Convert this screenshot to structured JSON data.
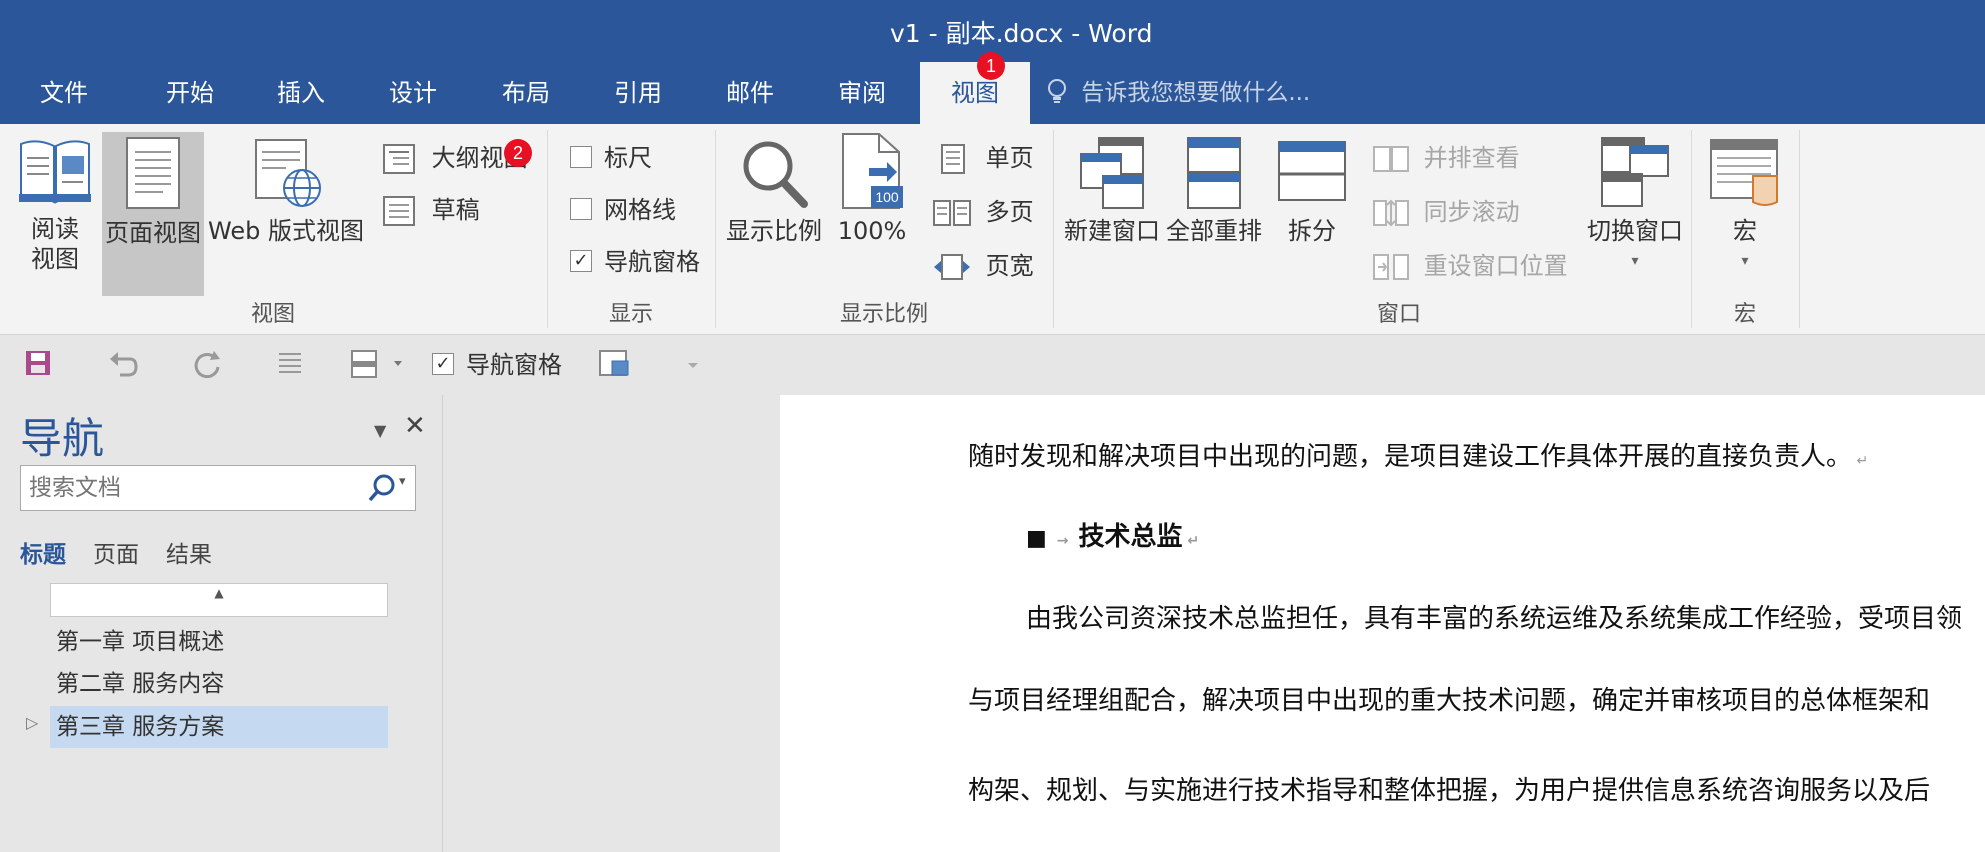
{
  "window": {
    "title": "v1 - 副本.docx - Word"
  },
  "ribbon_tabs": [
    {
      "label": "文件"
    },
    {
      "label": "开始"
    },
    {
      "label": "插入"
    },
    {
      "label": "设计"
    },
    {
      "label": "布局"
    },
    {
      "label": "引用"
    },
    {
      "label": "邮件"
    },
    {
      "label": "审阅"
    },
    {
      "label": "视图",
      "active": true
    }
  ],
  "badges": {
    "tab_badge": "1",
    "outline_badge": "2"
  },
  "tell_me": {
    "text": "告诉我您想要做什么..."
  },
  "views_group": {
    "label": "视图",
    "read_mode": "阅读\n视图",
    "read_mode_line1": "阅读",
    "read_mode_line2": "视图",
    "print_layout": "页面视图",
    "web_layout": "Web 版式视图",
    "outline": "大纲视图",
    "draft": "草稿"
  },
  "show_group": {
    "label": "显示",
    "ruler": "标尺",
    "gridlines": "网格线",
    "nav_pane": "导航窗格",
    "ruler_checked": false,
    "gridlines_checked": false,
    "nav_pane_checked": true
  },
  "zoom_group": {
    "label": "显示比例",
    "zoom": "显示比例",
    "hundred": "100%",
    "hundred_icon_text": "100",
    "one_page": "单页",
    "multi_page": "多页",
    "page_width": "页宽"
  },
  "window_group": {
    "label": "窗口",
    "new_window": "新建窗口",
    "arrange_all": "全部重排",
    "split": "拆分",
    "side_by_side": "并排查看",
    "sync_scroll": "同步滚动",
    "reset_position": "重设窗口位置",
    "switch_windows": "切换窗口"
  },
  "macros_group": {
    "label": "宏",
    "macros": "宏"
  },
  "qat": {
    "nav_pane": "导航窗格",
    "nav_pane_checked": true
  },
  "nav": {
    "title": "导航",
    "search_placeholder": "搜索文档",
    "tabs": [
      "标题",
      "页面",
      "结果"
    ],
    "active_tab": "标题",
    "headings": [
      {
        "text": "第一章 项目概述",
        "selected": false,
        "expandable": false
      },
      {
        "text": "第二章 服务内容",
        "selected": false,
        "expandable": false
      },
      {
        "text": "第三章 服务方案",
        "selected": true,
        "expandable": true
      }
    ]
  },
  "document": {
    "line1": "随时发现和解决项目中出现的问题，是项目建设工作具体开展的直接负责人。",
    "heading_bullet": "■",
    "heading": "技术总监",
    "para_line1": "由我公司资深技术总监担任，具有丰富的系统运维及系统集成工作经验，受项目领",
    "para_line2": "与项目经理组配合，解决项目中出现的重大技术问题，确定并审核项目的总体框架和",
    "para_line3": "构架、规划、与实施进行技术指导和整体把握，为用户提供信息系统咨询服务以及后"
  },
  "colors": {
    "brand": "#2b579a",
    "badge": "#e81123",
    "selected_heading": "#c5d9f1"
  }
}
